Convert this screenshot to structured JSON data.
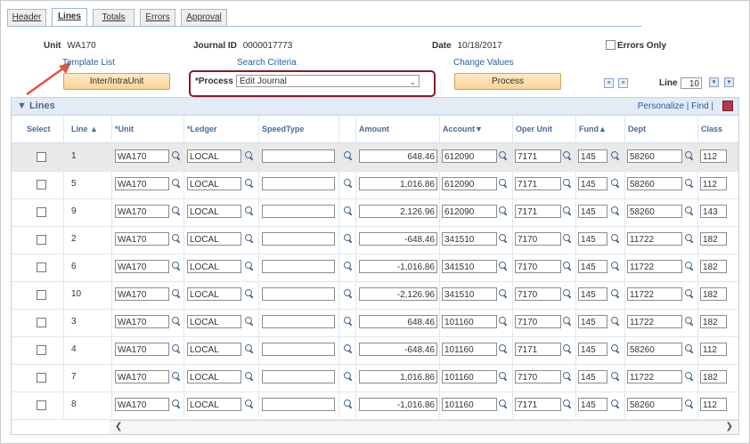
{
  "tabs": [
    {
      "label": "Header",
      "active": false
    },
    {
      "label": "Lines",
      "active": true
    },
    {
      "label": "Totals",
      "active": false
    },
    {
      "label": "Errors",
      "active": false
    },
    {
      "label": "Approval",
      "active": false
    }
  ],
  "header": {
    "unit_label": "Unit",
    "unit_value": "WA170",
    "journal_id_label": "Journal ID",
    "journal_id_value": "0000017773",
    "date_label": "Date",
    "date_value": "10/18/2017",
    "errors_only_label": "Errors Only",
    "template_list_link": "Template List",
    "search_criteria_link": "Search Criteria",
    "change_values_link": "Change Values",
    "inter_intra_button": "Inter/IntraUnit",
    "process_label": "*Process",
    "process_value": "Edit Journal",
    "process_button": "Process",
    "line_label": "Line",
    "line_value": "10"
  },
  "grid": {
    "title": "Lines",
    "toolbar": "Personalize | Find |",
    "columns": [
      "Select",
      "Line",
      "*Unit",
      "*Ledger",
      "SpeedType",
      "Amount",
      "Account",
      "Oper Unit",
      "Fund",
      "Dept",
      "Class"
    ],
    "rows": [
      {
        "line": "1",
        "unit": "WA170",
        "ledger": "LOCAL",
        "speedtype": "",
        "amount": "648.46",
        "account": "612090",
        "oper_unit": "7171",
        "fund": "145",
        "dept": "58260",
        "class": "112"
      },
      {
        "line": "5",
        "unit": "WA170",
        "ledger": "LOCAL",
        "speedtype": "",
        "amount": "1,016.86",
        "account": "612090",
        "oper_unit": "7171",
        "fund": "145",
        "dept": "58260",
        "class": "112"
      },
      {
        "line": "9",
        "unit": "WA170",
        "ledger": "LOCAL",
        "speedtype": "",
        "amount": "2,126.96",
        "account": "612090",
        "oper_unit": "7171",
        "fund": "145",
        "dept": "58260",
        "class": "143"
      },
      {
        "line": "2",
        "unit": "WA170",
        "ledger": "LOCAL",
        "speedtype": "",
        "amount": "-648.46",
        "account": "341510",
        "oper_unit": "7170",
        "fund": "145",
        "dept": "11722",
        "class": "182"
      },
      {
        "line": "6",
        "unit": "WA170",
        "ledger": "LOCAL",
        "speedtype": "",
        "amount": "-1,016.86",
        "account": "341510",
        "oper_unit": "7170",
        "fund": "145",
        "dept": "11722",
        "class": "182"
      },
      {
        "line": "10",
        "unit": "WA170",
        "ledger": "LOCAL",
        "speedtype": "",
        "amount": "-2,126.96",
        "account": "341510",
        "oper_unit": "7170",
        "fund": "145",
        "dept": "11722",
        "class": "182"
      },
      {
        "line": "3",
        "unit": "WA170",
        "ledger": "LOCAL",
        "speedtype": "",
        "amount": "648.46",
        "account": "101160",
        "oper_unit": "7170",
        "fund": "145",
        "dept": "11722",
        "class": "182"
      },
      {
        "line": "4",
        "unit": "WA170",
        "ledger": "LOCAL",
        "speedtype": "",
        "amount": "-648.46",
        "account": "101160",
        "oper_unit": "7171",
        "fund": "145",
        "dept": "58260",
        "class": "112"
      },
      {
        "line": "7",
        "unit": "WA170",
        "ledger": "LOCAL",
        "speedtype": "",
        "amount": "1,016.86",
        "account": "101160",
        "oper_unit": "7170",
        "fund": "145",
        "dept": "11722",
        "class": "182"
      },
      {
        "line": "8",
        "unit": "WA170",
        "ledger": "LOCAL",
        "speedtype": "",
        "amount": "-1,016.86",
        "account": "101160",
        "oper_unit": "7171",
        "fund": "145",
        "dept": "58260",
        "class": "112"
      }
    ]
  },
  "colors": {
    "accent_link": "#1f5fa8",
    "highlight_border": "#8b1a2b",
    "arrow": "#e0553e",
    "button_fill": "#f8d597"
  }
}
